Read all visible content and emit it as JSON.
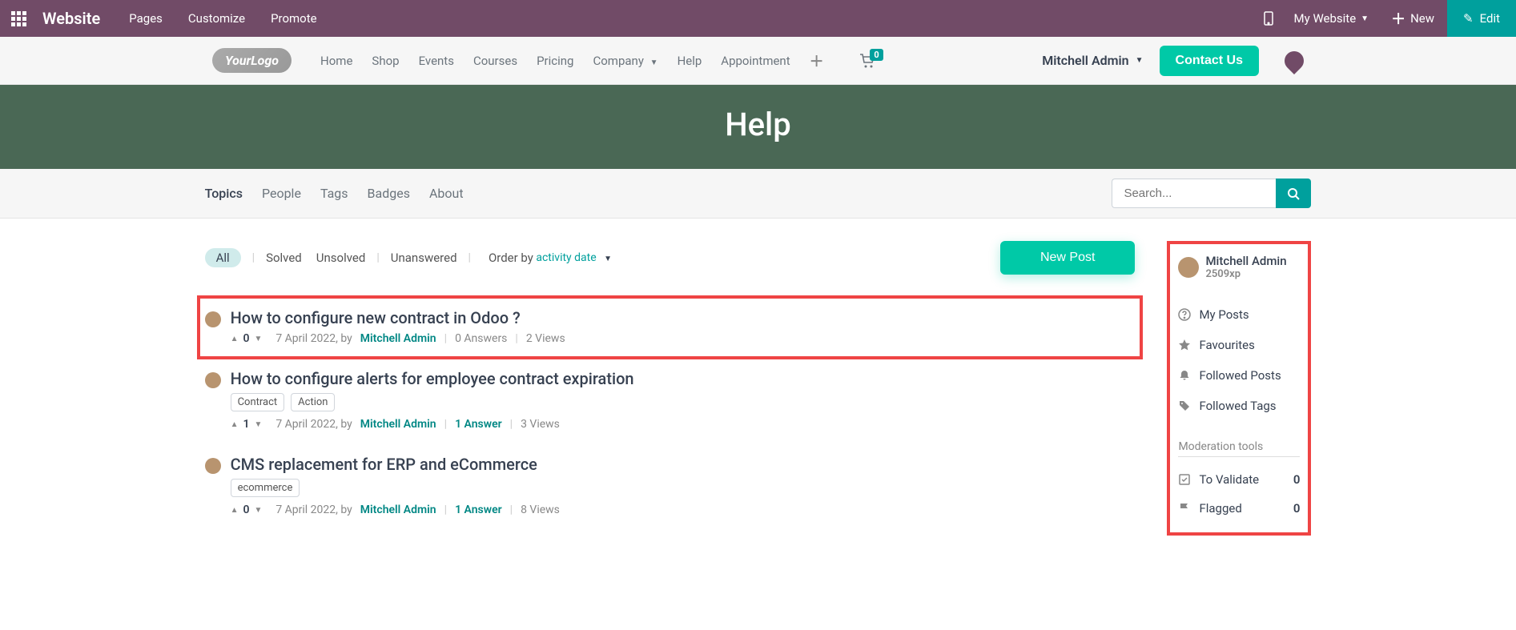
{
  "top": {
    "brand": "Website",
    "menu": [
      "Pages",
      "Customize",
      "Promote"
    ],
    "mywebsite": "My Website",
    "new": "New",
    "edit": "Edit"
  },
  "nav": {
    "logo": "YourLogo",
    "links": [
      "Home",
      "Shop",
      "Events",
      "Courses",
      "Pricing",
      "Company",
      "Help",
      "Appointment"
    ],
    "cart_count": "0",
    "user": "Mitchell Admin",
    "contact": "Contact Us"
  },
  "banner": {
    "title": "Help"
  },
  "subnav": {
    "items": [
      "Topics",
      "People",
      "Tags",
      "Badges",
      "About"
    ],
    "search_placeholder": "Search..."
  },
  "filters": {
    "all": "All",
    "items": [
      "Solved",
      "Unsolved"
    ],
    "unanswered": "Unanswered",
    "order_label": "Order by",
    "order_value": "activity date"
  },
  "new_post": "New Post",
  "posts": [
    {
      "title": "How to configure new contract in Odoo ?",
      "tags": [],
      "votes": "0",
      "date": "7 April 2022,",
      "by": "by",
      "author": "Mitchell Admin",
      "answers": "0 Answers",
      "views": "2 Views",
      "highlighted": true
    },
    {
      "title": "How to configure alerts for employee contract expiration",
      "tags": [
        "Contract",
        "Action"
      ],
      "votes": "1",
      "date": "7 April 2022,",
      "by": "by",
      "author": "Mitchell Admin",
      "answers": "1 Answer",
      "views": "3 Views",
      "highlighted": false,
      "ans_colored": true
    },
    {
      "title": "CMS replacement for ERP and eCommerce",
      "tags": [
        "ecommerce"
      ],
      "votes": "0",
      "date": "7 April 2022,",
      "by": "by",
      "author": "Mitchell Admin",
      "answers": "1 Answer",
      "views": "8 Views",
      "highlighted": false,
      "ans_colored": true
    }
  ],
  "sidebar": {
    "username": "Mitchell Admin",
    "xp": "2509xp",
    "links": [
      {
        "icon": "question",
        "label": "My Posts"
      },
      {
        "icon": "star",
        "label": "Favourites"
      },
      {
        "icon": "bell",
        "label": "Followed Posts"
      },
      {
        "icon": "tag",
        "label": "Followed Tags"
      }
    ],
    "mod_header": "Moderation tools",
    "mod": [
      {
        "icon": "check",
        "label": "To Validate",
        "count": "0"
      },
      {
        "icon": "flag",
        "label": "Flagged",
        "count": "0"
      }
    ]
  }
}
